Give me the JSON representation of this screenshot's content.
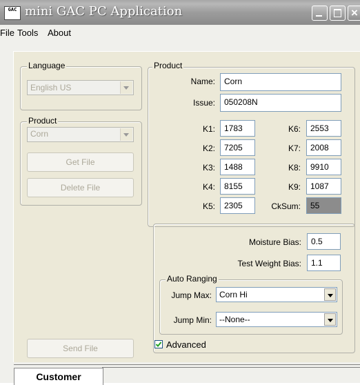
{
  "window": {
    "icon_text": "GAC",
    "title": "mini GAC PC Application"
  },
  "menu": {
    "items": [
      {
        "label": "File"
      },
      {
        "label": "Tools"
      },
      {
        "label": "About"
      }
    ]
  },
  "left": {
    "language_group": "Language",
    "language_value": "English US",
    "product_group": "Product",
    "product_value": "Corn",
    "get_file_label": "Get File",
    "delete_file_label": "Delete File",
    "send_file_label": "Send File"
  },
  "product": {
    "group_label": "Product",
    "name_label": "Name:",
    "name_value": "Corn",
    "issue_label": "Issue:",
    "issue_value": "050208N",
    "k_left": [
      {
        "label": "K1:",
        "value": "1783"
      },
      {
        "label": "K2:",
        "value": "7205"
      },
      {
        "label": "K3:",
        "value": "1488"
      },
      {
        "label": "K4:",
        "value": "8155"
      },
      {
        "label": "K5:",
        "value": "2305"
      }
    ],
    "k_right": [
      {
        "label": "K6:",
        "value": "2553"
      },
      {
        "label": "K7:",
        "value": "2008"
      },
      {
        "label": "K8:",
        "value": "9910"
      },
      {
        "label": "K9:",
        "value": "1087"
      },
      {
        "label": "CkSum:",
        "value": "55"
      }
    ]
  },
  "advanced": {
    "moisture_label": "Moisture Bias:",
    "moisture_value": "0.5",
    "testweight_label": "Test Weight Bias:",
    "testweight_value": "1.1",
    "auto_ranging_label": "Auto Ranging",
    "jump_max_label": "Jump Max:",
    "jump_max_value": "Corn Hi",
    "jump_min_label": "Jump Min:",
    "jump_min_value": "--None--",
    "checkbox_label": "Advanced",
    "checkbox_checked": true
  },
  "tabs": [
    {
      "label": "Customer"
    }
  ],
  "colors": {
    "cksum_bg": "#8c8c8c",
    "title_text": "#ffffff"
  }
}
